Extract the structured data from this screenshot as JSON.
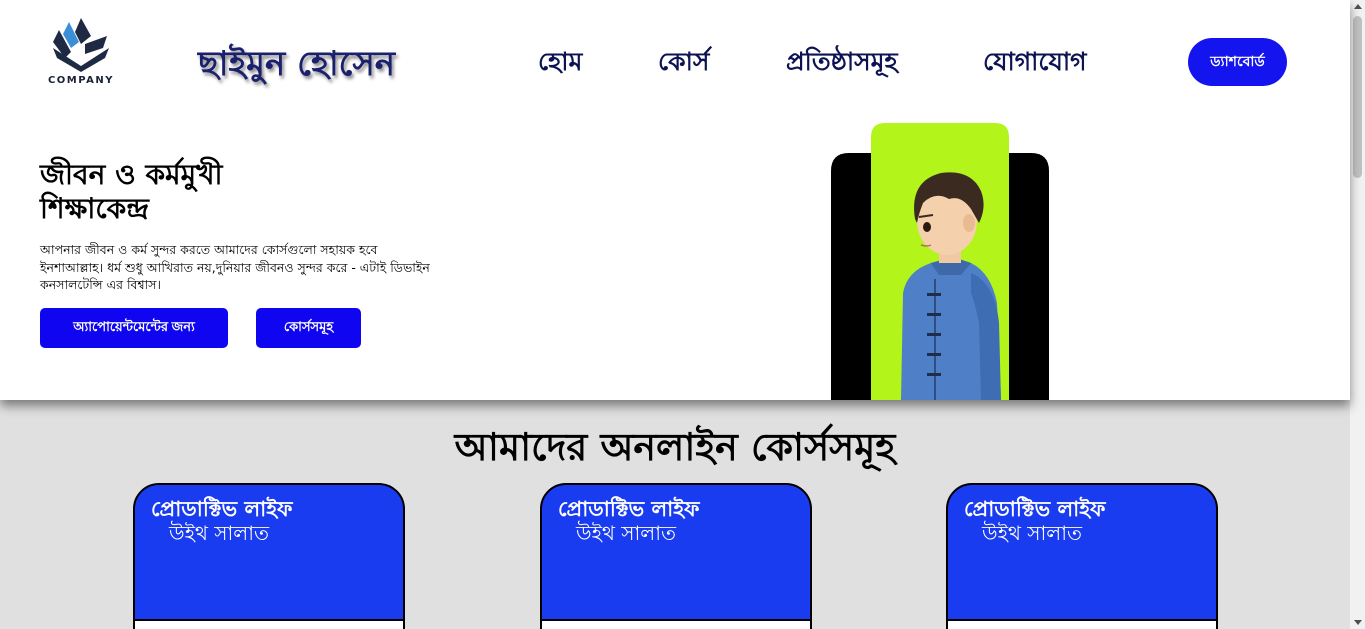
{
  "brand": {
    "logo_text": "COMPANY",
    "name": "ছাইমুন হোসেন"
  },
  "nav": {
    "items": [
      {
        "label": "হোম"
      },
      {
        "label": "কোর্স"
      },
      {
        "label": "প্রতিষ্ঠাসমূহ"
      },
      {
        "label": "যোগাযোগ"
      }
    ],
    "dashboard_label": "ড্যাশবোর্ড"
  },
  "hero": {
    "title_line1": "জীবন ও কর্মমুখী",
    "title_line2": "শিক্ষাকেন্দ্র",
    "description": "আপনার জীবন ও কর্ম সুন্দর করতে আমাদের কোর্সগুলো সহায়ক হবে ইনশাআল্লাহ। ধর্ম শুধু আখিরাত নয়,দুনিয়ার জীবনও সুন্দর করে - এটাই ডিভাইন কনসালটেন্সি এর বিশ্বাস।",
    "appointment_button": "অ্যাপোয়েন্টমেন্টের জন্য",
    "courses_button": "কোর্সসমূহ",
    "image_icon": "boy-portrait-illustration"
  },
  "courses": {
    "heading": "আমাদের অনলাইন কোর্সসমূহ",
    "cards": [
      {
        "title": "প্রোডাক্টিভ লাইফ",
        "subtitle": "উইথ সালাত"
      },
      {
        "title": "প্রোডাক্টিভ লাইফ",
        "subtitle": "উইথ সালাত"
      },
      {
        "title": "প্রোডাক্টিভ লাইফ",
        "subtitle": "উইথ সালাত"
      }
    ]
  },
  "colors": {
    "primary_blue": "#1414ee",
    "card_blue": "#1a3cf0",
    "nav_text": "#0c1352",
    "accent_green": "#b3f51b",
    "section_bg": "#e0e0e0"
  }
}
